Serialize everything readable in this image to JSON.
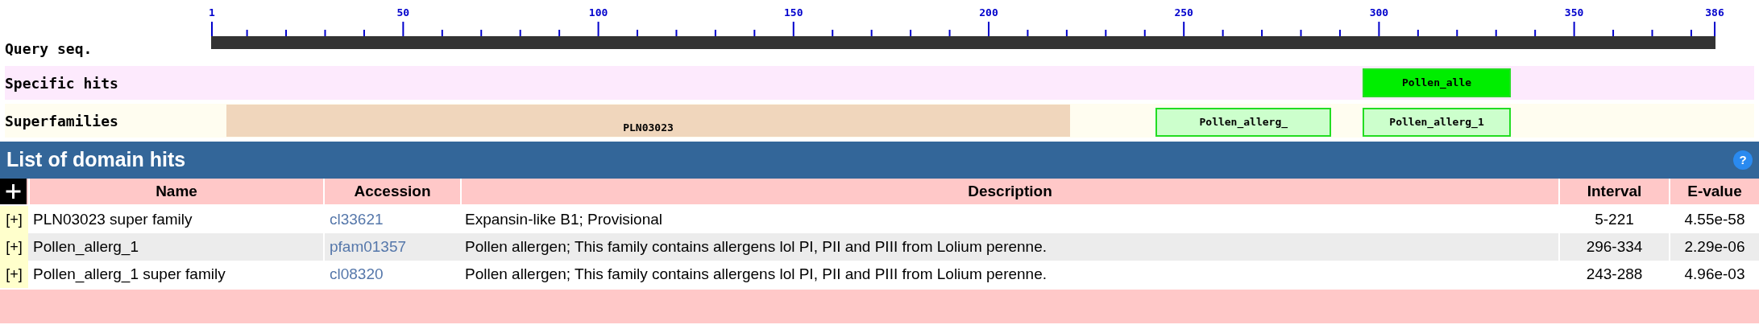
{
  "graphic": {
    "ruler": {
      "ticks": [
        "1",
        "50",
        "100",
        "150",
        "200",
        "250",
        "300",
        "350",
        "386"
      ]
    },
    "rows": [
      {
        "kind": "query",
        "label": "Query seq."
      },
      {
        "kind": "specific",
        "label": "Specific hits",
        "domains": [
          {
            "label": "Pollen_alle",
            "color": "#00ee00"
          }
        ]
      },
      {
        "kind": "superfamily",
        "label": "Superfamilies",
        "domains": [
          {
            "label": "PLN03023",
            "color": "#f0d6bc"
          },
          {
            "label": "Pollen_allerg_",
            "color": "#ccffcc"
          },
          {
            "label": "Pollen_allerg_1",
            "color": "#ccffcc"
          }
        ]
      }
    ]
  },
  "domain_hits": {
    "title": "List of domain hits",
    "help": "?",
    "columns": [
      "Name",
      "Accession",
      "Description",
      "Interval",
      "E-value"
    ],
    "rows": [
      {
        "expand": "[+]",
        "name": "PLN03023 super family",
        "accession": "cl33621",
        "description": "Expansin-like B1; Provisional",
        "interval": "5-221",
        "evalue": "4.55e-58"
      },
      {
        "expand": "[+]",
        "name": "Pollen_allerg_1",
        "accession": "pfam01357",
        "description": "Pollen allergen; This family contains allergens lol PI, PII and PIII from Lolium perenne.",
        "interval": "296-334",
        "evalue": "2.29e-06"
      },
      {
        "expand": "[+]",
        "name": "Pollen_allerg_1 super family",
        "accession": "cl08320",
        "description": "Pollen allergen; This family contains allergens lol PI, PII and PIII from Lolium perenne.",
        "interval": "243-288",
        "evalue": "4.96e-03"
      }
    ]
  }
}
